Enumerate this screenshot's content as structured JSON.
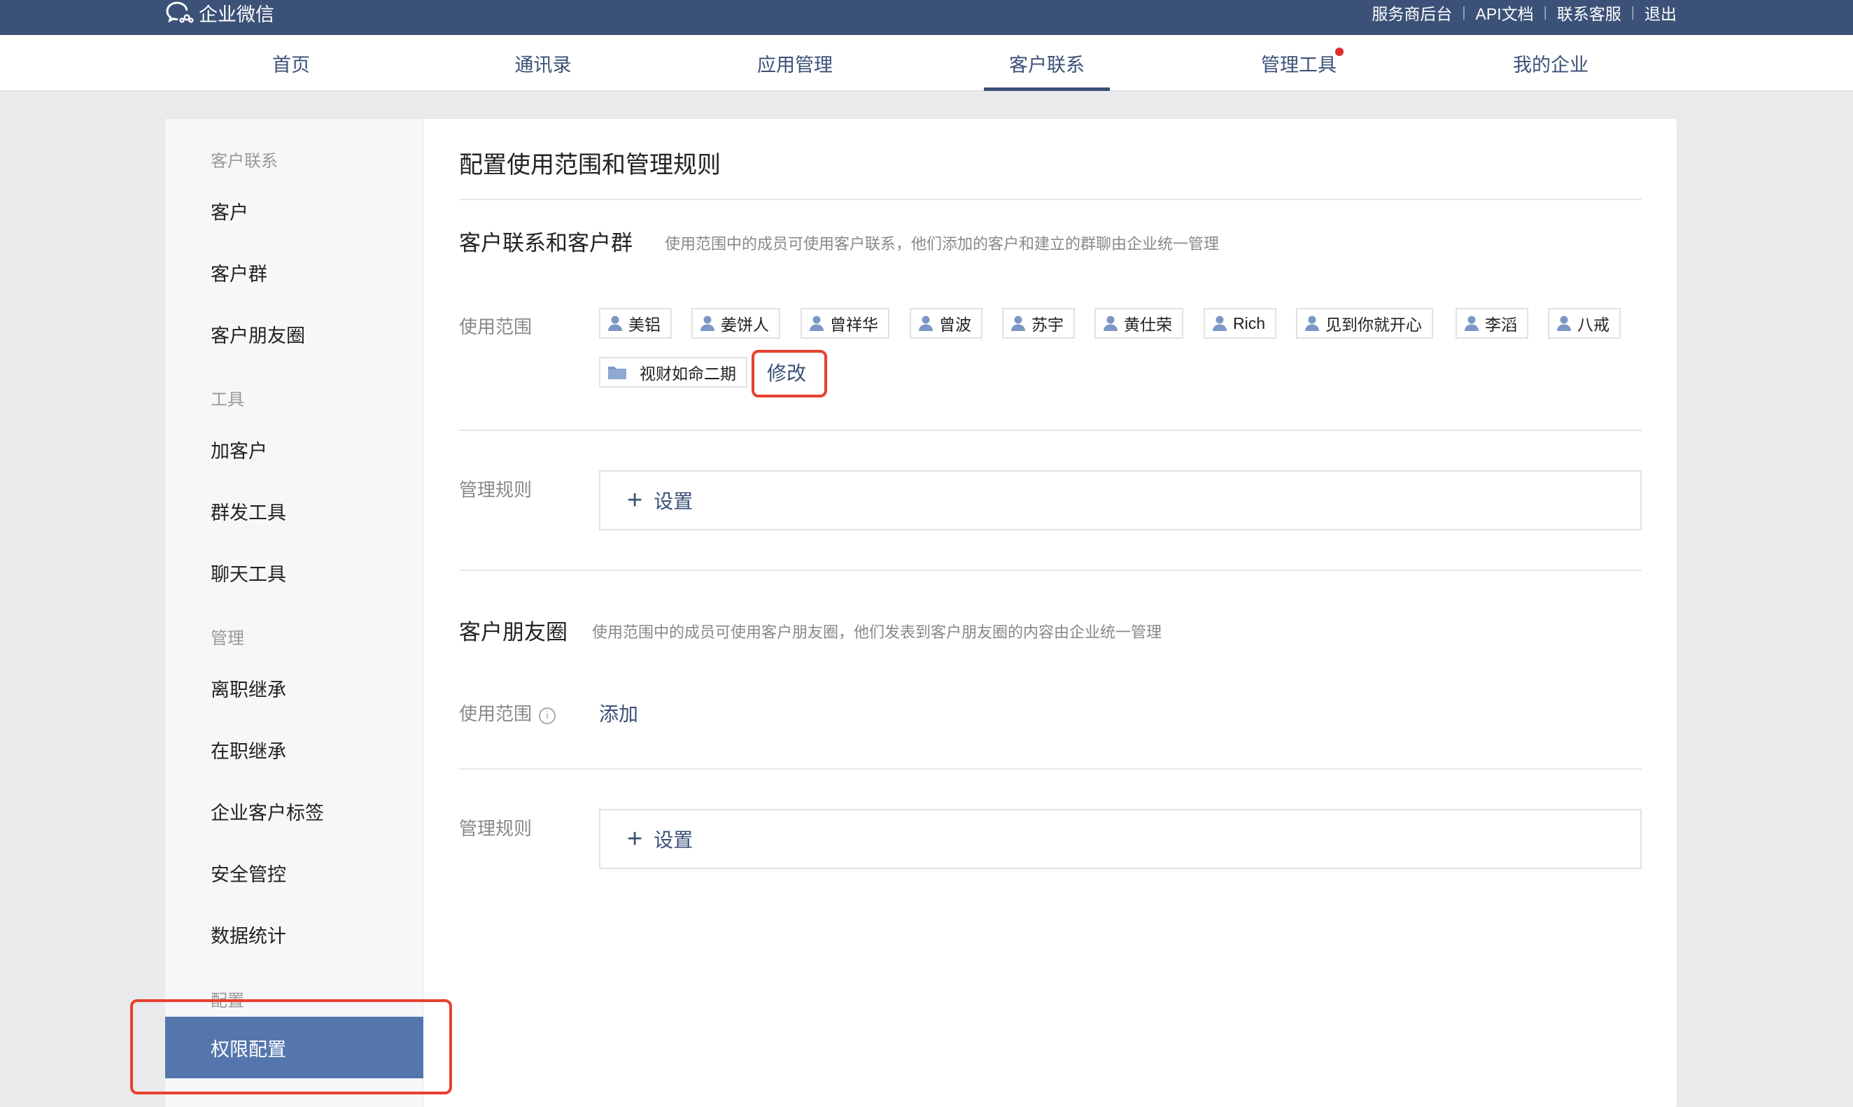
{
  "brand": {
    "name": "企业微信"
  },
  "toplinks": [
    "服务商后台",
    "API文档",
    "联系客服",
    "退出"
  ],
  "nav": {
    "tabs": [
      {
        "label": "首页"
      },
      {
        "label": "通讯录"
      },
      {
        "label": "应用管理"
      },
      {
        "label": "客户联系",
        "active": true
      },
      {
        "label": "管理工具",
        "has_notification_dot": true
      },
      {
        "label": "我的企业"
      }
    ]
  },
  "sidebar": {
    "groups": [
      {
        "title": "客户联系",
        "items": [
          "客户",
          "客户群",
          "客户朋友圈"
        ]
      },
      {
        "title": "工具",
        "items": [
          "加客户",
          "群发工具",
          "聊天工具"
        ]
      },
      {
        "title": "管理",
        "items": [
          "离职继承",
          "在职继承",
          "企业客户标签",
          "安全管控",
          "数据统计"
        ]
      },
      {
        "title": "配置",
        "items": [
          "权限配置"
        ]
      }
    ],
    "active_item": "权限配置"
  },
  "main": {
    "title": "配置使用范围和管理规则",
    "section1": {
      "title": "客户联系和客户群",
      "desc": "使用范围中的成员可使用客户联系，他们添加的客户和建立的群聊由企业统一管理",
      "scope_label": "使用范围",
      "members": [
        "美铝",
        "姜饼人",
        "曾祥华",
        "曾波",
        "苏宇",
        "黄仕荣",
        "Rich",
        "见到你就开心",
        "李滔",
        "八戒"
      ],
      "department": "视财如命二期",
      "modify_link": "修改",
      "rules_label": "管理规则",
      "rules_button": "设置"
    },
    "section2": {
      "title": "客户朋友圈",
      "desc": "使用范围中的成员可使用客户朋友圈，他们发表到客户朋友圈的内容由企业统一管理",
      "scope_label": "使用范围",
      "add_link": "添加",
      "rules_label": "管理规则",
      "rules_button": "设置"
    }
  },
  "colors": {
    "topbar": "#3b5177",
    "accent": "#3b5177",
    "sidebar_active": "#5476ad",
    "highlight_box": "#e8402f",
    "notification_dot": "#e12d2d"
  },
  "icons": {
    "logo": "wecom-chat-bubbles-icon",
    "member": "person-icon",
    "department": "folder-icon",
    "add": "plus-icon",
    "info": "info-icon"
  }
}
